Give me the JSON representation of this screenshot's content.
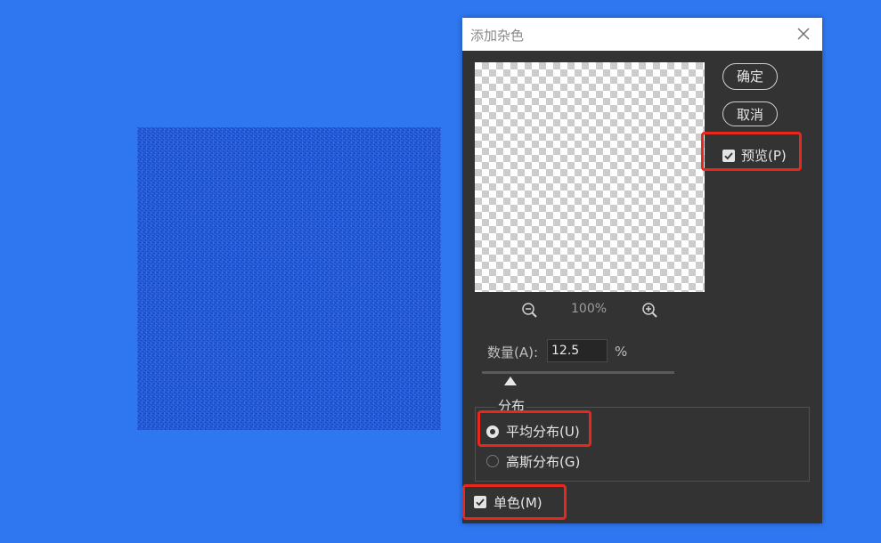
{
  "dialog": {
    "title": "添加杂色",
    "ok_label": "确定",
    "cancel_label": "取消",
    "preview_label": "预览(P)",
    "preview_checked": true,
    "zoom_level": "100%",
    "amount_label": "数量(A):",
    "amount_value": "12.5",
    "amount_unit": "%",
    "distribution_legend": "分布",
    "distribution_options": [
      {
        "label": "平均分布(U)",
        "selected": true
      },
      {
        "label": "高斯分布(G)",
        "selected": false
      }
    ],
    "monochrome_label": "单色(M)",
    "monochrome_checked": true
  },
  "colors": {
    "desktop_background": "#2f77f0",
    "noise_canvas": "#1f5cd6",
    "dialog_background": "#333333",
    "highlight": "#e8281d"
  },
  "icons": [
    "close-icon",
    "zoom-out-icon",
    "zoom-in-icon",
    "checkmark-icon"
  ]
}
